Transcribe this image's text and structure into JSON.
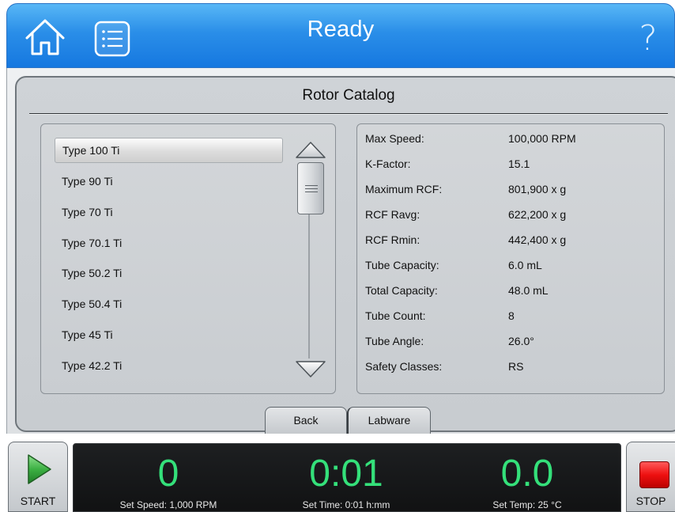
{
  "header": {
    "status": "Ready",
    "help_glyph": "?",
    "icons": {
      "home": "home-icon",
      "menu": "list-menu-icon",
      "help": "help-icon"
    }
  },
  "page": {
    "title": "Rotor Catalog"
  },
  "rotor_list": {
    "selected_index": 0,
    "items": [
      "Type 100 Ti",
      "Type 90 Ti",
      "Type 70 Ti",
      "Type 70.1 Ti",
      "Type 50.2 Ti",
      "Type 50.4 Ti",
      "Type 45 Ti",
      "Type 42.2 Ti"
    ]
  },
  "details": [
    {
      "label": "Max Speed:",
      "value": "100,000 RPM"
    },
    {
      "label": "K-Factor:",
      "value": "15.1"
    },
    {
      "label": "Maximum RCF:",
      "value": "801,900 x g"
    },
    {
      "label": "RCF Ravg:",
      "value": "622,200 x g"
    },
    {
      "label": "RCF Rmin:",
      "value": "442,400 x g"
    },
    {
      "label": "Tube Capacity:",
      "value": "6.0 mL"
    },
    {
      "label": "Total Capacity:",
      "value": "48.0 mL"
    },
    {
      "label": "Tube Count:",
      "value": "8"
    },
    {
      "label": "Tube Angle:",
      "value": "26.0°"
    },
    {
      "label": "Safety Classes:",
      "value": "RS"
    }
  ],
  "tabs": {
    "back": "Back",
    "labware": "Labware"
  },
  "run": {
    "start_label": "START",
    "stop_label": "STOP",
    "speed": {
      "value": "0",
      "set": "Set Speed: 1,000 RPM"
    },
    "time": {
      "value": "0:01",
      "set": "Set Time: 0:01 h:mm"
    },
    "temp": {
      "value": "0.0",
      "set": "Set Temp: 25 °C"
    }
  },
  "colors": {
    "header_blue": "#1678e0",
    "readout_green": "#34e07a",
    "stop_red": "#e11111",
    "start_green": "#3cb043"
  }
}
